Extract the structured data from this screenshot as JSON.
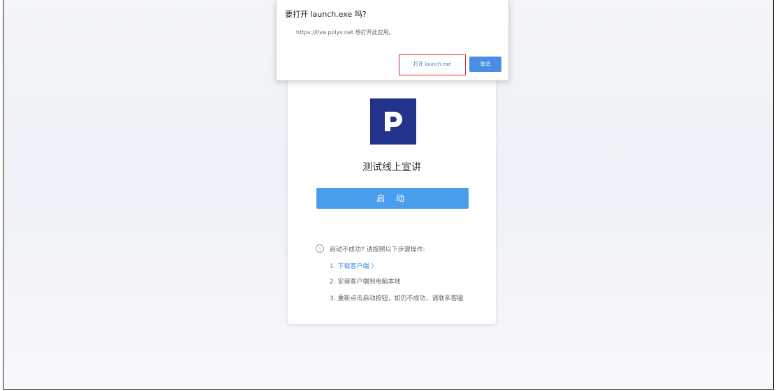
{
  "dialog": {
    "title": "要打开 launch.exe 吗?",
    "message": "https://live.polyv.net 想打开此应用。",
    "open_label": "打开 launch.exe",
    "cancel_label": "取消"
  },
  "card": {
    "logo_icon": "polyv-logo-icon",
    "title": "测试线上宣讲",
    "launch_label": "启 动",
    "help": {
      "heading": "启动不成功? 请按照以下步骤操作:",
      "info_icon": "info-circle-icon",
      "steps": [
        "1. 下载客户端 〉",
        "2. 安装客户端到电脑本地",
        "3. 重新点击启动按钮，如仍不成功，请联系客服"
      ]
    }
  },
  "colors": {
    "logo_bg": "#23328a",
    "primary": "#4a9cec",
    "highlight_border": "#e0282d",
    "link": "#3a8ee6"
  }
}
